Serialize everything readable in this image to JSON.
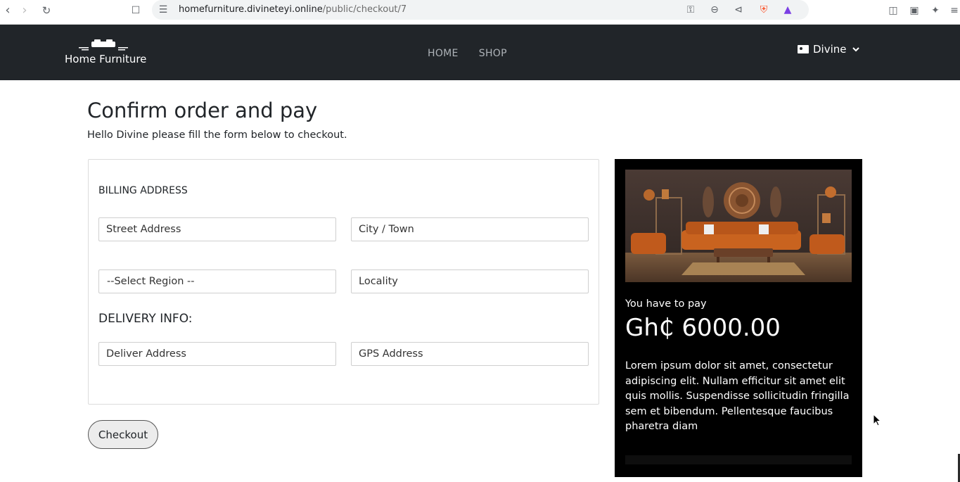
{
  "browser": {
    "url_host": "homefurniture.divineteyi.online",
    "url_path": "/public/checkout/7",
    "icons": [
      "back-icon",
      "forward-icon",
      "reload-icon",
      "bookmark-icon",
      "site-settings-icon",
      "password-key-icon",
      "zoom-out-icon",
      "share-icon",
      "brave-shield-icon",
      "brave-rewards-icon",
      "sidebar-icon",
      "wallet-icon",
      "leo-ai-icon",
      "menu-icon"
    ]
  },
  "header": {
    "logo_text": "Home Furniture",
    "nav": [
      {
        "label": "HOME"
      },
      {
        "label": "SHOP"
      }
    ],
    "user_name": "Divine",
    "colors": {
      "background": "#212529",
      "link": "#aeb3b8"
    }
  },
  "main": {
    "title": "Confirm order and pay",
    "subtitle": "Hello Divine please fill the form below to checkout."
  },
  "form": {
    "billing_heading": "BILLING ADDRESS",
    "street_placeholder": "Street Address",
    "city_placeholder": "City / Town",
    "region_selected": "--Select Region --",
    "locality_placeholder": "Locality",
    "delivery_heading": "DELIVERY INFO:",
    "deliver_placeholder": "Deliver Address",
    "gps_placeholder": "GPS Address",
    "checkout_label": "Checkout"
  },
  "summary": {
    "pay_label": "You have to pay",
    "amount": "Gh₵ 6000.00",
    "description": "Lorem ipsum dolor sit amet, consectetur adipiscing elit. Nullam efficitur sit amet elit quis mollis. Suspendisse sollicitudin fringilla sem et bibendum. Pellentesque faucibus pharetra diam",
    "colors": {
      "background": "#000000",
      "text": "#ffffff"
    }
  }
}
